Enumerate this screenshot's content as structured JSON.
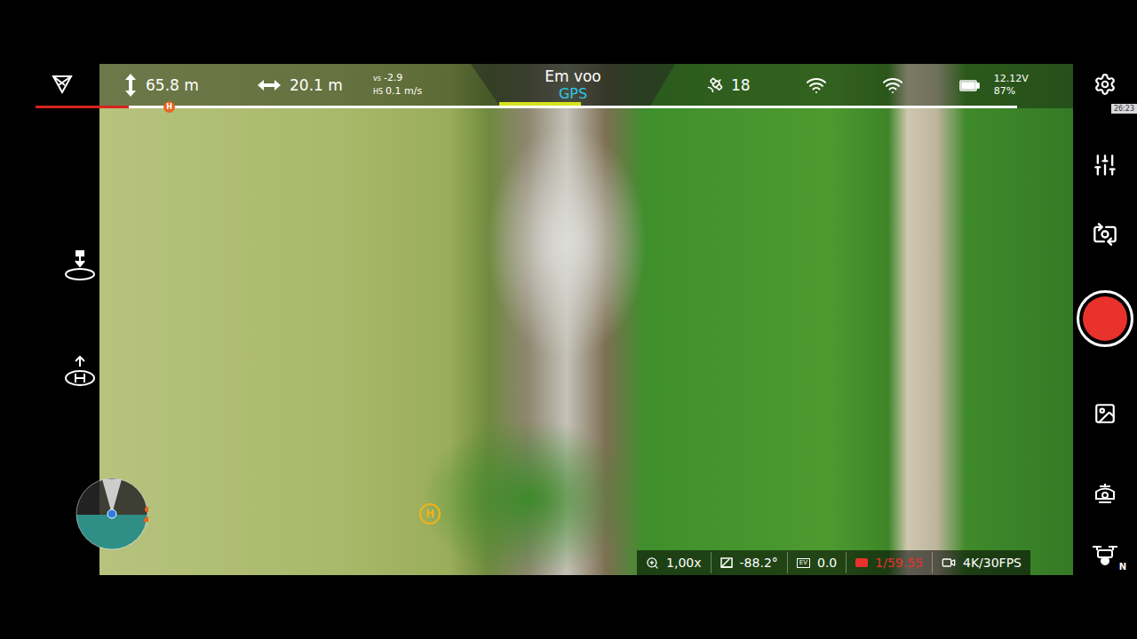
{
  "top_bar": {
    "altitude": "65.8 m",
    "distance": "20.1 m",
    "vertical_speed": {
      "label": "vs",
      "value": "-2.9"
    },
    "horizontal_speed": {
      "label": "HS",
      "value": "0.1 m/s"
    },
    "flight_status": "Em voo",
    "positioning": "GPS",
    "satellites": "18",
    "battery": {
      "voltage": "12.12V",
      "percent": "87%"
    }
  },
  "home_marker": "H",
  "home_point": "H",
  "time_badge": "26:23",
  "camera_settings": [
    {
      "kind": "zoom",
      "value": "1,00x",
      "color": "#ffffff"
    },
    {
      "kind": "pitch",
      "value": "-88.2°",
      "color": "#ffffff"
    },
    {
      "kind": "ev",
      "icon_text": "EV",
      "value": "0.0",
      "color": "#ffffff"
    },
    {
      "kind": "shutter",
      "value": "1/59.55",
      "color": "#e8322b"
    },
    {
      "kind": "resolution",
      "value": "4K/30FPS",
      "color": "#ffffff"
    }
  ],
  "record": {
    "recording": false
  },
  "drone_mode_badge": "N"
}
